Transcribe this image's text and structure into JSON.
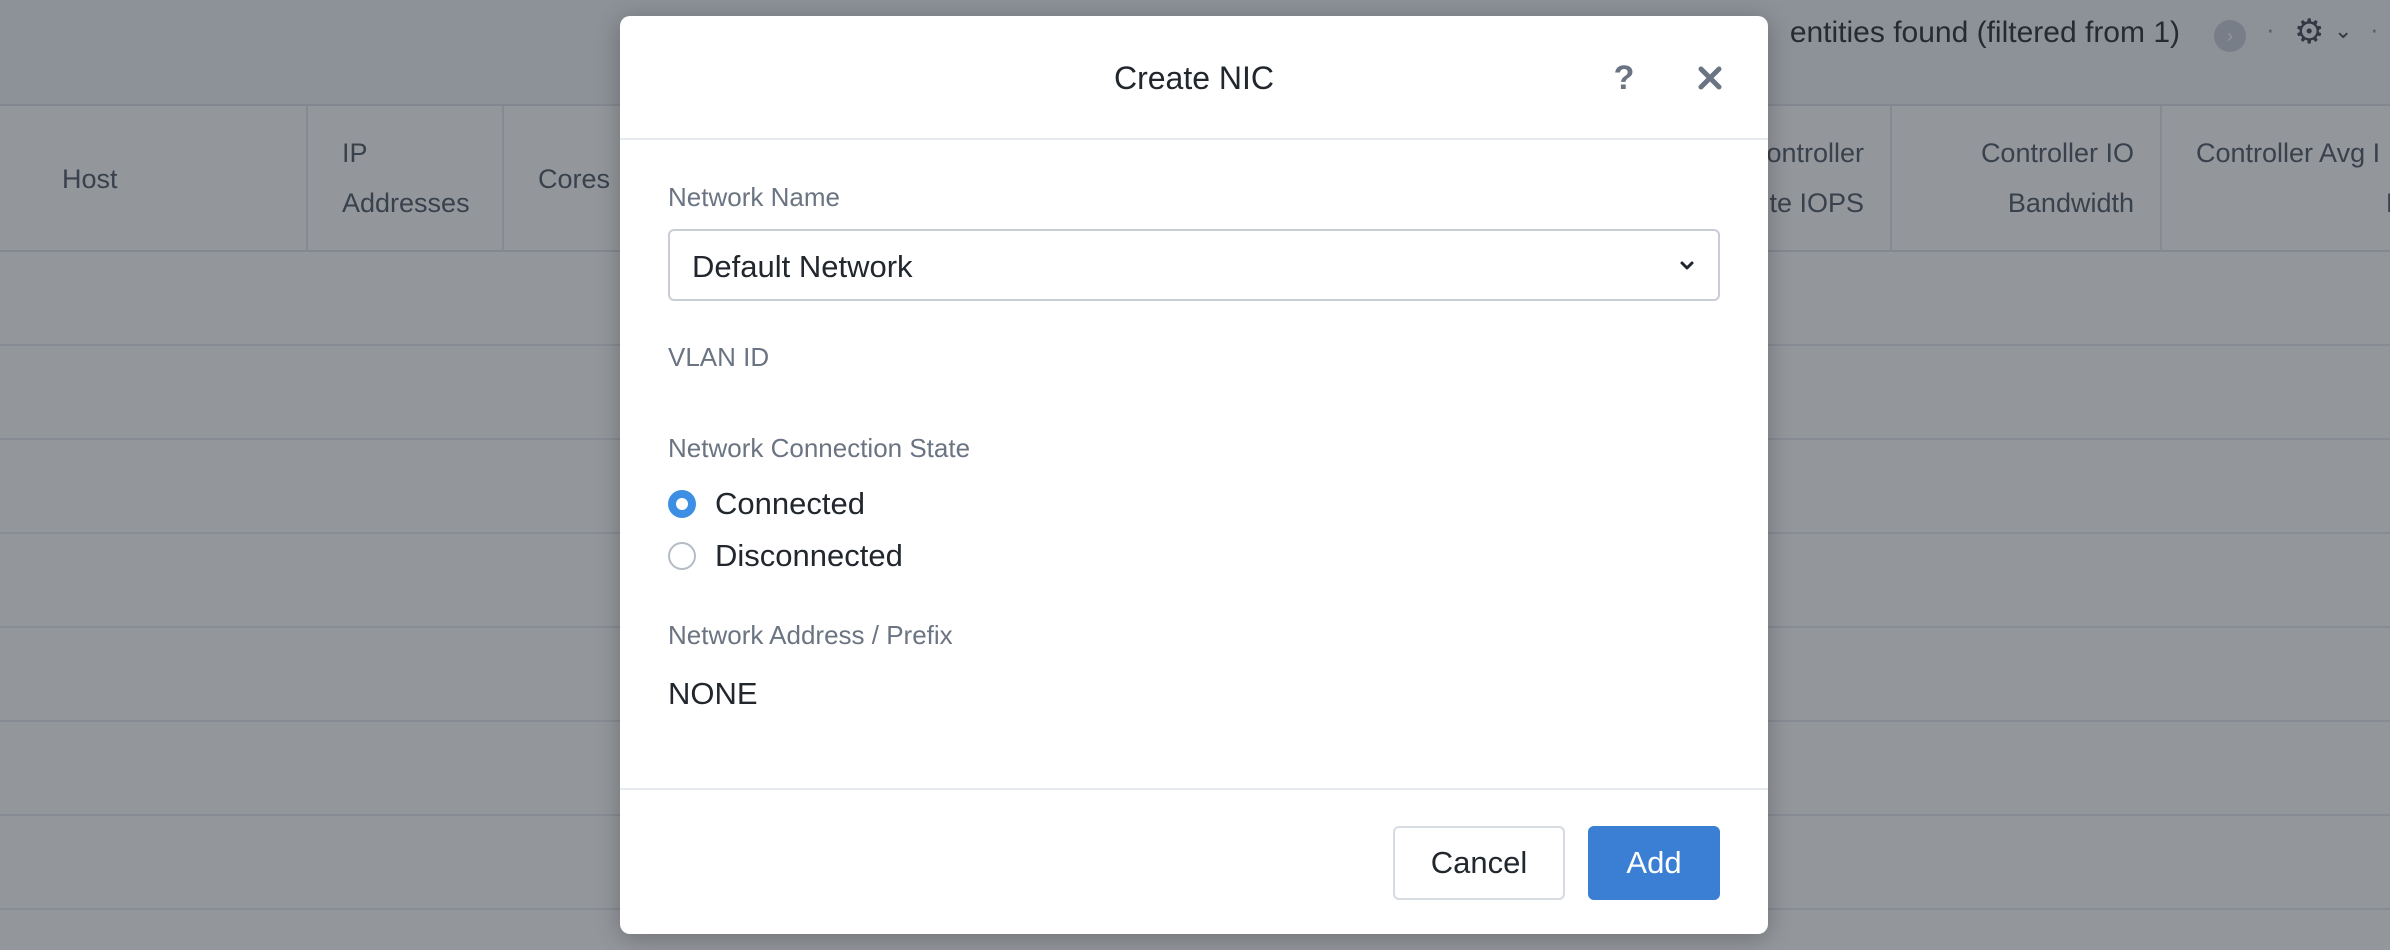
{
  "background": {
    "entities_text": "entities found (filtered from 1)",
    "next_icon": "chevron-right-icon",
    "separator": "·",
    "settings_icon": "gear-icon",
    "settings_caret": "chevron-down-icon",
    "columns": [
      {
        "line1": "Host",
        "line2": ""
      },
      {
        "line1": "IP",
        "line2": "Addresses"
      },
      {
        "line1": "Cores",
        "line2": ""
      },
      {
        "line1": "ontroller",
        "line2": "ite IOPS"
      },
      {
        "line1": "Controller IO",
        "line2": "Bandwidth"
      },
      {
        "line1": "Controller Avg I",
        "line2": "Latenc"
      }
    ]
  },
  "modal": {
    "title": "Create NIC",
    "help_label": "?",
    "network_name_label": "Network Name",
    "network_name_value": "Default Network",
    "vlan_label": "VLAN ID",
    "connection_state_label": "Network Connection State",
    "connection_options": [
      {
        "label": "Connected",
        "selected": true
      },
      {
        "label": "Disconnected",
        "selected": false
      }
    ],
    "address_label": "Network Address / Prefix",
    "address_value": "NONE",
    "cancel_label": "Cancel",
    "add_label": "Add"
  },
  "colors": {
    "accent": "#3a7fd4",
    "radio_selected": "#3d8fe3"
  }
}
